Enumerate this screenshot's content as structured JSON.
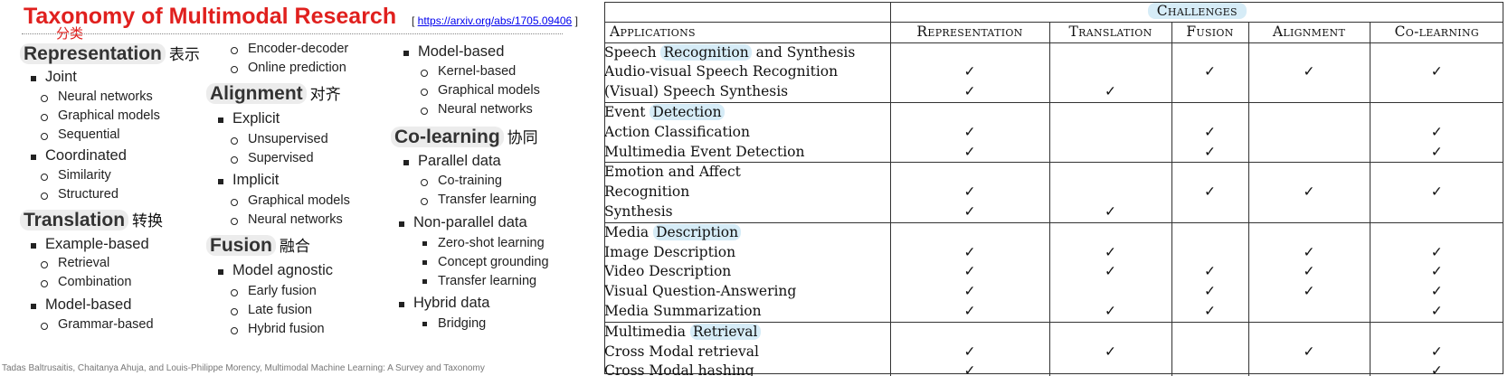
{
  "left": {
    "title": "Taxonomy of Multimodal Research",
    "subtitle_cn": "分类",
    "ref_open": "[ ",
    "ref_link": "https://arxiv.org/abs/1705.09406",
    "ref_close": " ]",
    "credit": "Tadas Baltrusaitis, Chaitanya Ahuja, and Louis-Philippe Morency, Multimodal Machine Learning: A Survey and Taxonomy",
    "representation": {
      "label": "Representation",
      "cn": "表示",
      "joint": "Joint",
      "joint_items": [
        "Neural networks",
        "Graphical models",
        "Sequential"
      ],
      "coordinated": "Coordinated",
      "coordinated_items": [
        "Similarity",
        "Structured"
      ]
    },
    "translation": {
      "label": "Translation",
      "cn": "转换",
      "example_based": "Example-based",
      "example_items": [
        "Retrieval",
        "Combination"
      ],
      "model_based": "Model-based",
      "model_items": [
        "Grammar-based"
      ],
      "model_items_col2": [
        "Encoder-decoder",
        "Online prediction"
      ]
    },
    "alignment": {
      "label": "Alignment",
      "cn": "对齐",
      "explicit": "Explicit",
      "explicit_items": [
        "Unsupervised",
        "Supervised"
      ],
      "implicit": "Implicit",
      "implicit_items": [
        "Graphical models",
        "Neural networks"
      ]
    },
    "fusion": {
      "label": "Fusion",
      "cn": "融合",
      "model_agnostic": "Model agnostic",
      "agnostic_items": [
        "Early fusion",
        "Late fusion",
        "Hybrid fusion"
      ],
      "model_based": "Model-based",
      "model_items": [
        "Kernel-based",
        "Graphical models",
        "Neural networks"
      ]
    },
    "colearning": {
      "label": "Co-learning",
      "cn": "协同",
      "parallel": "Parallel data",
      "parallel_items": [
        "Co-training",
        "Transfer learning"
      ],
      "non_parallel": "Non-parallel data",
      "non_parallel_items": [
        "Zero-shot learning",
        "Concept grounding",
        "Transfer learning"
      ],
      "hybrid": "Hybrid data",
      "hybrid_items": [
        "Bridging"
      ]
    }
  },
  "table": {
    "challenges_label": "Challenges",
    "applications_label": "Applications",
    "columns": [
      "Representation",
      "Translation",
      "Fusion",
      "Alignment",
      "Co-learning"
    ],
    "check": "✓",
    "groups": [
      {
        "name_pre": "Speech ",
        "name_hl": "Recognition",
        "name_post": " and Synthesis",
        "rows": [
          {
            "name": "Audio-visual Speech Recognition",
            "checks": [
              1,
              0,
              1,
              1,
              1
            ]
          },
          {
            "name": "(Visual) Speech Synthesis",
            "checks": [
              1,
              1,
              0,
              0,
              0
            ]
          }
        ]
      },
      {
        "name_pre": "Event ",
        "name_hl": "Detection",
        "name_post": "",
        "rows": [
          {
            "name": "Action Classification",
            "checks": [
              1,
              0,
              1,
              0,
              1
            ]
          },
          {
            "name": "Multimedia Event Detection",
            "checks": [
              1,
              0,
              1,
              0,
              1
            ]
          }
        ]
      },
      {
        "name_pre": "Emotion and Affect",
        "name_hl": "",
        "name_post": "",
        "rows": [
          {
            "name": "Recognition",
            "checks": [
              1,
              0,
              1,
              1,
              1
            ]
          },
          {
            "name": "Synthesis",
            "checks": [
              1,
              1,
              0,
              0,
              0
            ]
          }
        ]
      },
      {
        "name_pre": "Media ",
        "name_hl": "Description",
        "name_post": "",
        "rows": [
          {
            "name": "Image Description",
            "checks": [
              1,
              1,
              0,
              1,
              1
            ]
          },
          {
            "name": "Video Description",
            "checks": [
              1,
              1,
              1,
              1,
              1
            ]
          },
          {
            "name": "Visual Question-Answering",
            "checks": [
              1,
              0,
              1,
              1,
              1
            ]
          },
          {
            "name": "Media Summarization",
            "checks": [
              1,
              1,
              1,
              0,
              1
            ]
          }
        ]
      },
      {
        "name_pre": "Multimedia ",
        "name_hl": "Retrieval",
        "name_post": "",
        "rows": [
          {
            "name": "Cross Modal retrieval",
            "checks": [
              1,
              1,
              0,
              1,
              1
            ]
          },
          {
            "name": "Cross Modal hashing",
            "checks": [
              1,
              0,
              0,
              0,
              1
            ]
          }
        ]
      }
    ]
  },
  "colors": {
    "title_red": "#e0201e",
    "highlight_blue": "#d6ecf7",
    "highlight_gray": "#ececec"
  }
}
